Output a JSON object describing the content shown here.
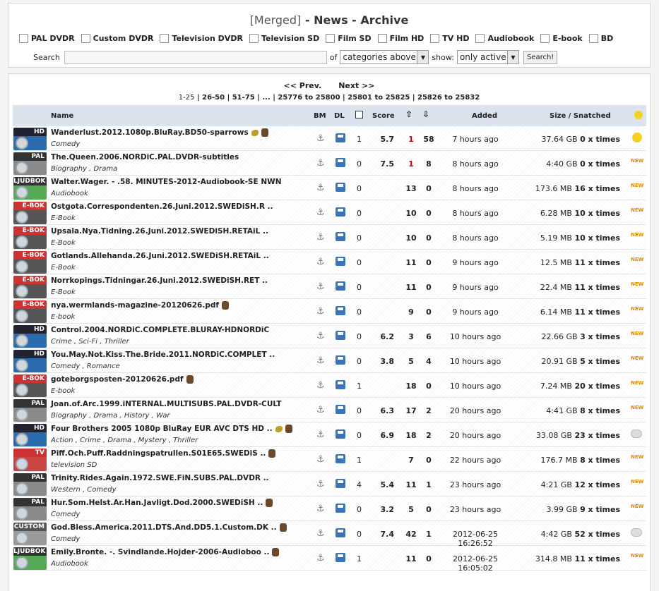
{
  "title": {
    "merged": "[Merged]",
    "rest": " - News - Archive"
  },
  "categories": [
    "PAL DVDR",
    "Custom DVDR",
    "Television DVDR",
    "Television SD",
    "Film SD",
    "Film HD",
    "TV HD",
    "Audiobook",
    "E-book",
    "BD"
  ],
  "search": {
    "label": "Search",
    "in_label": "of",
    "cat_select": "categories above,",
    "show_label": "show:",
    "show_select": "only active",
    "button": "Search!"
  },
  "pager": {
    "prev": "<< Prev.",
    "next": "Next >>",
    "pages": [
      "1-25",
      "26-50",
      "51-75",
      "...",
      "25776 to 25800",
      "25801 to 25825",
      "25826 to 25832"
    ]
  },
  "headers": {
    "name": "Name",
    "bm": "BM",
    "dl": "DL",
    "score": "Score",
    "added": "Added",
    "size": "Size / Snatched"
  },
  "rows": [
    {
      "icon": "hd",
      "label": "HD",
      "name": "Wanderlust.2012.1080p.BluRay.BD50-sparrows",
      "cat": "Comedy",
      "com": "1",
      "score": "5.7",
      "up": "1",
      "down": "58",
      "added": "7 hours ago",
      "size": "37.64 GB",
      "snatch": "0 x times",
      "badge": "sun",
      "extras": [
        "bird",
        "uploader"
      ],
      "uprRed": true
    },
    {
      "icon": "pal",
      "label": "PAL",
      "name": "The.Queen.2006.NORDiC.PAL.DVDR-subtitles",
      "cat": "Biography , Drama",
      "com": "0",
      "score": "7.5",
      "up": "1",
      "down": "8",
      "added": "8 hours ago",
      "size": "4:40 GB",
      "snatch": "0 x times",
      "badge": "new",
      "extras": [],
      "uprRed": true
    },
    {
      "icon": "ljud",
      "label": "LJUDBOK",
      "name": "Walter.Wager. - .58. MINUTES-2012-Audiobook-SE NWN",
      "cat": "Audiobook",
      "com": "0",
      "score": "",
      "up": "13",
      "down": "0",
      "added": "8 hours ago",
      "size": "173.6 MB",
      "snatch": "16 x times",
      "badge": "new",
      "extras": []
    },
    {
      "icon": "ebok",
      "label": "E-BOK",
      "name": "Ostgota.Correspondenten.26.Juni.2012.SWEDiSH.R ..",
      "cat": "E-Book",
      "com": "0",
      "score": "",
      "up": "10",
      "down": "0",
      "added": "8 hours ago",
      "size": "6.28 MB",
      "snatch": "10 x times",
      "badge": "new",
      "extras": []
    },
    {
      "icon": "ebok",
      "label": "E-BOK",
      "name": "Upsala.Nya.Tidning.26.Juni.2012.SWEDiSH.RETAiL ..",
      "cat": "E-Book",
      "com": "0",
      "score": "",
      "up": "10",
      "down": "0",
      "added": "8 hours ago",
      "size": "5.19 MB",
      "snatch": "10 x times",
      "badge": "new",
      "extras": []
    },
    {
      "icon": "ebok",
      "label": "E-BOK",
      "name": "Gotlands.Allehanda.26.Juni.2012.SWEDiSH.RETAiL ..",
      "cat": "E-Book",
      "com": "0",
      "score": "",
      "up": "11",
      "down": "0",
      "added": "9 hours ago",
      "size": "12.5 MB",
      "snatch": "11 x times",
      "badge": "new",
      "extras": []
    },
    {
      "icon": "ebok",
      "label": "E-BOK",
      "name": "Norrkopings.Tidningar.26.Juni.2012.SWEDiSH.RET ..",
      "cat": "E-Book",
      "com": "0",
      "score": "",
      "up": "11",
      "down": "0",
      "added": "9 hours ago",
      "size": "22.4 MB",
      "snatch": "11 x times",
      "badge": "new",
      "extras": []
    },
    {
      "icon": "ebok",
      "label": "E-BOK",
      "name": "nya.wermlands-magazine-20120626.pdf",
      "cat": "E-book",
      "com": "0",
      "score": "",
      "up": "9",
      "down": "0",
      "added": "9 hours ago",
      "size": "6.14 MB",
      "snatch": "11 x times",
      "badge": "new",
      "extras": [
        "uploader"
      ]
    },
    {
      "icon": "hd",
      "label": "HD",
      "name": "Control.2004.NORDiC.COMPLETE.BLURAY-HDNORDiC",
      "cat": "Crime , Sci-Fi , Thriller",
      "com": "0",
      "score": "6.2",
      "up": "3",
      "down": "6",
      "added": "10 hours ago",
      "size": "22.66 GB",
      "snatch": "3 x times",
      "badge": "new",
      "extras": []
    },
    {
      "icon": "hd",
      "label": "HD",
      "name": "You.May.Not.Kiss.The.Bride.2011.NORDiC.COMPLET ..",
      "cat": "Comedy , Romance",
      "com": "0",
      "score": "3.8",
      "up": "5",
      "down": "4",
      "added": "10 hours ago",
      "size": "20.91 GB",
      "snatch": "5 x times",
      "badge": "new",
      "extras": []
    },
    {
      "icon": "ebok",
      "label": "E-BOK",
      "name": "goteborgsposten-20120626.pdf",
      "cat": "E-book",
      "com": "1",
      "score": "",
      "up": "18",
      "down": "0",
      "added": "10 hours ago",
      "size": "7.24 MB",
      "snatch": "20 x times",
      "badge": "new",
      "extras": [
        "uploader"
      ]
    },
    {
      "icon": "pal",
      "label": "PAL",
      "name": "Joan.of.Arc.1999.iNTERNAL.MULTISUBS.PAL.DVDR-CULT",
      "cat": "Biography , Drama , History , War",
      "com": "0",
      "score": "6.3",
      "up": "17",
      "down": "2",
      "added": "20 hours ago",
      "size": "4:41 GB",
      "snatch": "8 x times",
      "badge": "new",
      "extras": []
    },
    {
      "icon": "hd",
      "label": "HD",
      "name": "Four Brothers 2005 1080p BluRay EUR AVC DTS HD ..",
      "cat": "Action , Crime , Drama , Mystery , Thriller",
      "com": "0",
      "score": "6.9",
      "up": "18",
      "down": "2",
      "added": "20 hours ago",
      "size": "33.08 GB",
      "snatch": "23 x times",
      "badge": "cloud",
      "extras": [
        "bird",
        "uploader"
      ]
    },
    {
      "icon": "tv",
      "label": "TV",
      "name": "Piff.Och.Puff.Raddningspatrullen.S01E65.SWEDiS ..",
      "cat": "television SD",
      "com": "1",
      "score": "",
      "up": "7",
      "down": "0",
      "added": "22 hours ago",
      "size": "176.7 MB",
      "snatch": "8 x times",
      "badge": "new",
      "extras": [
        "uploader"
      ]
    },
    {
      "icon": "pal",
      "label": "PAL",
      "name": "Trinity.Rides.Again.1972.SWE.FiN.SUBS.PAL.DVDR ..",
      "cat": "Western , Comedy",
      "com": "4",
      "score": "5.4",
      "up": "11",
      "down": "1",
      "added": "23 hours ago",
      "size": "4:21 GB",
      "snatch": "12 x times",
      "badge": "new",
      "extras": []
    },
    {
      "icon": "pal",
      "label": "PAL",
      "name": "Hur.Som.Helst.Ar.Han.Javligt.Dod.2000.SWEDiSH ..",
      "cat": "Comedy",
      "com": "0",
      "score": "3.2",
      "up": "5",
      "down": "0",
      "added": "23 hours ago",
      "size": "3.99 GB",
      "snatch": "9 x times",
      "badge": "new",
      "extras": [
        "uploader"
      ]
    },
    {
      "icon": "custom",
      "label": "CUSTOM",
      "name": "God.Bless.America.2011.DTS.And.DD5.1.Custom.DK ..",
      "cat": "Comedy",
      "com": "0",
      "score": "7.4",
      "up": "42",
      "down": "1",
      "added": "2012-06-25 16:26:52",
      "size": "4:42 GB",
      "snatch": "52 x times",
      "badge": "cloud",
      "extras": [
        "uploader"
      ]
    },
    {
      "icon": "ljud",
      "label": "LJUDBOK",
      "name": "Emily.Bronte. -. Svindlande.Hojder-2006-Audioboo ..",
      "cat": "Audiobook",
      "com": "1",
      "score": "",
      "up": "11",
      "down": "0",
      "added": "2012-06-25 16:05:02",
      "size": "314.8 MB",
      "snatch": "11 x times",
      "badge": "new",
      "extras": [
        "uploader"
      ]
    }
  ],
  "badge_new": "NEW"
}
